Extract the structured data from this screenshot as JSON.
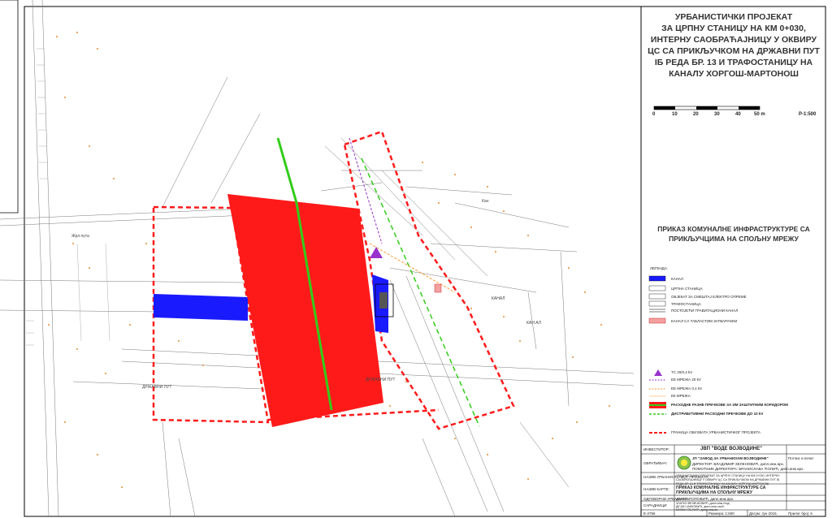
{
  "colors": {
    "red": "#ff1a1a",
    "blue": "#1a1aff",
    "green": "#33cc1a",
    "orange": "#ff9933",
    "purple": "#9933cc",
    "frame": "#000000"
  },
  "title": {
    "line1": "УРБАНИСТИЧКИ ПРОЈЕКАТ",
    "line2": "ЗА ЦРПНУ СТАНИЦУ НА КМ 0+030,",
    "line3": "ИНТЕРНУ САОБРАЋАЈНИЦУ У ОКВИРУ",
    "line4": "ЦС СА ПРИКЉУЧКОМ НА ДРЖАВНИ ПУТ",
    "line5": "IБ РЕДА БР. 13 И ТРАФОСТАНИЦУ НА",
    "line6": "КАНАЛУ ХОРГОШ-МАРТОНОШ"
  },
  "scale": {
    "ticks": [
      "0",
      "10",
      "20",
      "30",
      "40",
      "50 m"
    ],
    "ratio": "Р-1:500"
  },
  "subtitle": {
    "line1": "ПРИКАЗ КОМУНАЛНЕ ИНФРАСТРУКТУРЕ СА",
    "line2": "ПРИКЉУЧЦИМА НА СПОЉНУ МРЕЖУ"
  },
  "legend": {
    "heading": "ЛЕГЕНДА:",
    "items": [
      {
        "label": "КАНАЛ",
        "icon": "blue-fill-swatch"
      },
      {
        "label": "ЦРПНА СТАНИЦА",
        "icon": "numbered-box-1"
      },
      {
        "label": "ОБЈЕКАТ ЗА СМЕШТАЈ ЕЛЕКТРО ОПРЕМЕ",
        "icon": "numbered-box-2"
      },
      {
        "label": "ТРАФОСТАНИЦА",
        "icon": "numbered-box-3"
      },
      {
        "label": "ПОСТОЈЕЋИ ГРАВИТАЦИОНИ КАНАЛ",
        "icon": "double-line"
      },
      {
        "label": "КАНАЛ СА ТАБЛАСТИМ ЗАТВАРАЧЕМ",
        "icon": "pink-fill-swatch"
      }
    ],
    "items2": [
      {
        "label": "ТС 20/0,4 kV",
        "icon": "purple-triangle-icon"
      },
      {
        "label": "ЕЕ МРЕЖА 20 kV",
        "icon": "purple-dashed-line"
      },
      {
        "label": "ЕЕ МРЕЖА 0,4 kV",
        "icon": "orange-dashed-line"
      },
      {
        "label": "ЕК МРЕЖА",
        "icon": "orange-thin-line"
      },
      {
        "label": "РАСХОДНЕ РАЗНЕ ПРЕЧКОВЕ ЗА ИМ ЗАШТИТНИМ КОРИДОРОМ",
        "icon": "red-green-band"
      },
      {
        "label": "ДИСТРИБУТИВНИ РАСХОДНИ ПРЕЧКОВЕ ДО 10 kV",
        "icon": "green-dashed-line"
      },
      {
        "label": "ГРАНИЦА ОБУХВАТА УРБАНИСТИЧКОГ ПРОЈЕКТА",
        "icon": "red-dashed-line"
      }
    ]
  },
  "titleblock": {
    "investor_label": "ИНВЕСТИТОР:",
    "investor_value": "ЈВП \"ВОДЕ ВОЈВОДИНЕ\"",
    "maker_label": "ОБРАЂИВАЧ:",
    "maker_value": "ЈП \"ЗАВОД ЗА УРБАНИЗАМ ВОЈВОДИНЕ\"",
    "maker_line2": "ДИРЕКТОР: ВЛАДИМИР ЗЕЛЕНОВИЋ, дипл.инж.арх.",
    "maker_line3": "ПОМОЋНИК ДИРЕКТОРА: БРАНИСЛАВА ЋОЛИЋ, дипл.инж.арх.",
    "object_label": "НАЗИВ УРБАНИСТИЧКОГ ПРОЈЕКТА:",
    "object_value": "УРБАНИСТИЧКИ ПРОЈЕКАТ ЗА ЦРПНУ СТАНИЦУ НА КМ 0+030, ИНТЕРНУ САОБРАЋАЈНИЦУ У ОКВИРУ ЦС СА ПРИКЉУЧКОМ НА ДРЖАВНИ ПУТ IБ РЕДА БР. 13 И ТРАФОСТАНИЦУ НА КАНАЛУ ХОРГОШ-МАРТОНОШ",
    "drawing_label": "НАЗИВ КАРТЕ:",
    "drawing_value": "ПРИКАЗ КОМУНАЛНЕ ИНФРАСТРУКТУРЕ СА ПРИКЉУЧЦИМА НА СПОЉНУ МРЕЖУ",
    "author_label": "ОДГОВОРНИ УРБАНИСТА:",
    "author_value": "ДАНКА ПОПОВИЋ, дипл.инж.арх.",
    "team_label": "САРАДНИЦИ:",
    "team_value1": "ЗЛАТКО ВЕЛИЧКОВИЋ, дипл.инж.геод.",
    "team_value2": "ДЕЈАН ЈАНКОВИЋ, дипл.инж.саоб.",
    "team_value3": "МИЛАН ПЕЈЧИЋ, дипл.инж.ел.",
    "number": "Е-2756",
    "scale": "Размера: 1:500",
    "date": "Датум: Јун 2015.",
    "sheet": "Прилог број: 6",
    "sign": "Потпис и печат"
  },
  "map_labels": {
    "kanal1": "КАНАЛ",
    "kanal2": "КАН.АЛ",
    "road1": "ДРЖАВНИ ПУТ",
    "road2": "ДРЖАВНИ ПУТ",
    "road3": "Жрл.пута",
    "veza": "Кан"
  }
}
